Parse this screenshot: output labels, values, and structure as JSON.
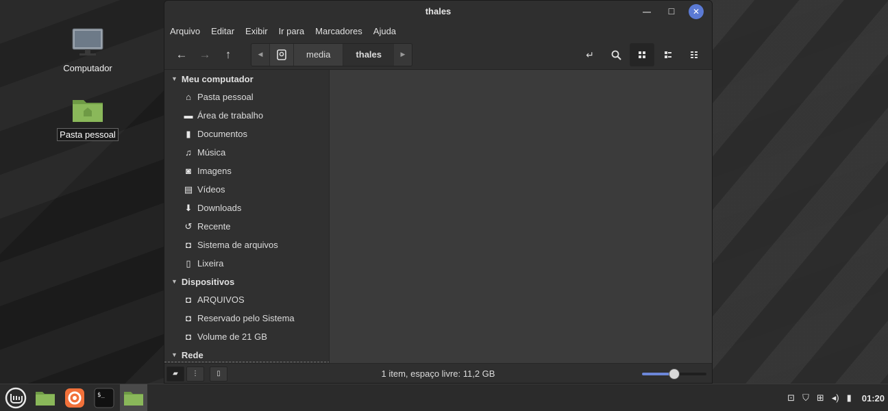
{
  "desktop": {
    "icons": [
      {
        "label": "Computador"
      },
      {
        "label": "Pasta pessoal"
      }
    ]
  },
  "window": {
    "title": "thales",
    "menu": [
      "Arquivo",
      "Editar",
      "Exibir",
      "Ir para",
      "Marcadores",
      "Ajuda"
    ],
    "path": [
      "media",
      "thales"
    ],
    "sidebar": {
      "sections": [
        {
          "title": "Meu computador",
          "items": [
            {
              "label": "Pasta pessoal",
              "icon": "home-icon"
            },
            {
              "label": "Área de trabalho",
              "icon": "desktop-icon"
            },
            {
              "label": "Documentos",
              "icon": "document-icon"
            },
            {
              "label": "Música",
              "icon": "music-icon"
            },
            {
              "label": "Imagens",
              "icon": "camera-icon"
            },
            {
              "label": "Vídeos",
              "icon": "film-icon"
            },
            {
              "label": "Downloads",
              "icon": "download-icon"
            },
            {
              "label": "Recente",
              "icon": "history-icon"
            },
            {
              "label": "Sistema de arquivos",
              "icon": "drive-icon"
            },
            {
              "label": "Lixeira",
              "icon": "trash-icon"
            }
          ]
        },
        {
          "title": "Dispositivos",
          "items": [
            {
              "label": "ARQUIVOS",
              "icon": "drive-icon"
            },
            {
              "label": "Reservado pelo Sistema",
              "icon": "drive-icon"
            },
            {
              "label": "Volume de 21 GB",
              "icon": "drive-icon"
            }
          ]
        },
        {
          "title": "Rede",
          "items": []
        }
      ]
    },
    "status": "1 item, espaço livre: 11,2 GB",
    "zoom_level": 0.5
  },
  "taskbar": {
    "clock": "01:20"
  },
  "colors": {
    "accent": "#6c87d9",
    "close_button": "#5b7ad4",
    "folder_green": "#8ab85a"
  }
}
